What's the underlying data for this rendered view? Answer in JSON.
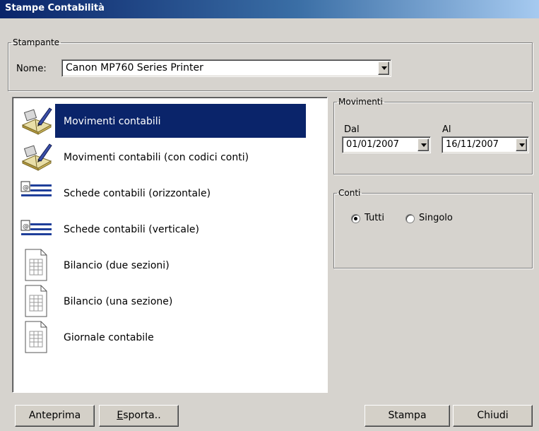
{
  "window": {
    "title": "Stampe Contabilità"
  },
  "printer": {
    "group_label": "Stampante",
    "name_label": "Nome:",
    "selected": "Canon MP760 Series Printer"
  },
  "reports": [
    {
      "label": "Movimenti contabili",
      "icon": "ledger-book-icon",
      "selected": true
    },
    {
      "label": "Movimenti contabili (con codici conti)",
      "icon": "ledger-book-icon",
      "selected": false
    },
    {
      "label": "Schede contabili (orizzontale)",
      "icon": "account-card-icon",
      "selected": false
    },
    {
      "label": "Schede contabili (verticale)",
      "icon": "account-card-icon",
      "selected": false
    },
    {
      "label": "Bilancio (due sezioni)",
      "icon": "document-icon",
      "selected": false
    },
    {
      "label": "Bilancio (una sezione)",
      "icon": "document-icon",
      "selected": false
    },
    {
      "label": "Giornale contabile",
      "icon": "document-icon",
      "selected": false
    }
  ],
  "movimenti": {
    "group_label": "Movimenti",
    "from_label": "Dal",
    "from_value": "01/01/2007",
    "to_label": "Al",
    "to_value": "16/11/2007"
  },
  "conti": {
    "group_label": "Conti",
    "options": [
      {
        "label": "Tutti",
        "checked": true
      },
      {
        "label": "Singolo",
        "checked": false
      }
    ]
  },
  "buttons": {
    "preview": "Anteprima",
    "export_first": "E",
    "export_rest": "sporta..",
    "print": "Stampa",
    "close": "Chiudi"
  },
  "colors": {
    "selection": "#0a246a",
    "face": "#d6d3ce"
  }
}
